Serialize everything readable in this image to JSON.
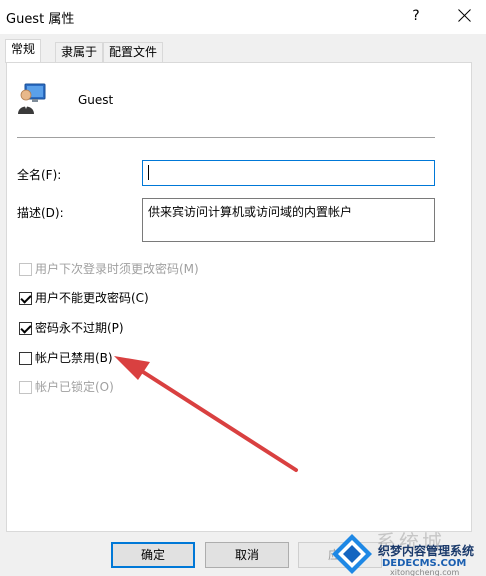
{
  "window": {
    "title": "Guest 属性",
    "help_label": "?"
  },
  "tabs": [
    {
      "label": "常规",
      "active": true
    },
    {
      "label": "隶属于",
      "active": false
    },
    {
      "label": "配置文件",
      "active": false
    }
  ],
  "user": {
    "name": "Guest",
    "icon": "user-account-icon"
  },
  "fields": {
    "fullname_label": "全名(F):",
    "fullname_value": "",
    "description_label": "描述(D):",
    "description_value": "供来宾访问计算机或访问域的内置帐户"
  },
  "checkboxes": [
    {
      "label": "用户下次登录时须更改密码(M)",
      "checked": false,
      "enabled": false
    },
    {
      "label": "用户不能更改密码(C)",
      "checked": true,
      "enabled": true
    },
    {
      "label": "密码永不过期(P)",
      "checked": true,
      "enabled": true
    },
    {
      "label": "帐户已禁用(B)",
      "checked": false,
      "enabled": true
    },
    {
      "label": "帐户已锁定(O)",
      "checked": false,
      "enabled": false
    }
  ],
  "buttons": {
    "ok": "确定",
    "cancel": "取消",
    "apply": "应用"
  },
  "watermark": {
    "big_text": "系统城",
    "line1": "织梦内容管理系统",
    "line2": "DEDECMS.COM",
    "line3": "xitongcheng.com"
  },
  "colors": {
    "accent": "#0078d7",
    "arrow": "#d94040"
  }
}
